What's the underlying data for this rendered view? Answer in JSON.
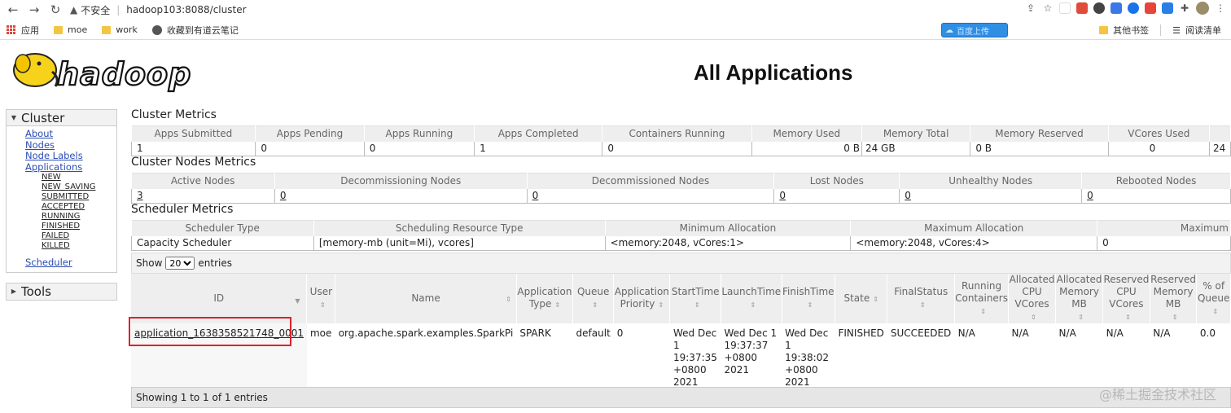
{
  "browser": {
    "security_label": "不安全",
    "url": "hadoop103:8088/cluster",
    "bookmarks": [
      {
        "label": "应用"
      },
      {
        "label": "moe"
      },
      {
        "label": "work"
      },
      {
        "label": "收藏到有道云笔记"
      }
    ],
    "cloud_button_label": "百度上传",
    "other_bookmarks": "其他书签",
    "reading_list": "阅读清单",
    "icons": [
      "back-arrow-icon",
      "forward-arrow-icon",
      "reload-icon",
      "warning-icon",
      "share-icon",
      "star-icon",
      "extensions-icon",
      "profile-avatar-icon"
    ]
  },
  "page": {
    "logo_text": "hadoop",
    "title": "All Applications"
  },
  "sidebar": {
    "cluster_label": "Cluster",
    "links": [
      "About",
      "Nodes",
      "Node Labels",
      "Applications"
    ],
    "app_states": [
      "NEW",
      "NEW_SAVING",
      "SUBMITTED",
      "ACCEPTED",
      "RUNNING",
      "FINISHED",
      "FAILED",
      "KILLED"
    ],
    "scheduler_label": "Scheduler",
    "tools_label": "Tools"
  },
  "cluster_metrics": {
    "title": "Cluster Metrics",
    "headers": [
      "Apps Submitted",
      "Apps Pending",
      "Apps Running",
      "Apps Completed",
      "Containers Running",
      "Memory Used",
      "Memory Total",
      "Memory Reserved",
      "VCores Used",
      ""
    ],
    "values": [
      "1",
      "0",
      "0",
      "1",
      "0",
      "0 B",
      "24 GB",
      "0 B",
      "0",
      "24"
    ]
  },
  "nodes_metrics": {
    "title": "Cluster Nodes Metrics",
    "headers": [
      "Active Nodes",
      "Decommissioning Nodes",
      "Decommissioned Nodes",
      "Lost Nodes",
      "Unhealthy Nodes",
      "Rebooted Nodes"
    ],
    "values": [
      "3",
      "0",
      "0",
      "0",
      "0",
      "0"
    ]
  },
  "scheduler_metrics": {
    "title": "Scheduler Metrics",
    "headers": [
      "Scheduler Type",
      "Scheduling Resource Type",
      "Minimum Allocation",
      "Maximum Allocation",
      "Maximum"
    ],
    "values": [
      "Capacity Scheduler",
      "[memory-mb (unit=Mi), vcores]",
      "<memory:2048, vCores:1>",
      "<memory:2048, vCores:4>",
      "0"
    ]
  },
  "apps_table": {
    "show_label": "Show",
    "page_size": "20",
    "entries_label": "entries",
    "headers": [
      "ID",
      "User",
      "Name",
      "Application Type",
      "Queue",
      "Application Priority",
      "StartTime",
      "LaunchTime",
      "FinishTime",
      "State",
      "FinalStatus",
      "Running Containers",
      "Allocated CPU VCores",
      "Allocated Memory MB",
      "Reserved CPU VCores",
      "Reserved Memory MB",
      "% of Queue"
    ],
    "rows": [
      [
        "application_1638358521748_0001",
        "moe",
        "org.apache.spark.examples.SparkPi",
        "SPARK",
        "default",
        "0",
        "Wed Dec 1 19:37:35 +0800 2021",
        "Wed Dec 1 19:37:37 +0800 2021",
        "Wed Dec 1 19:38:02 +0800 2021",
        "FINISHED",
        "SUCCEEDED",
        "N/A",
        "N/A",
        "N/A",
        "N/A",
        "N/A",
        "0.0"
      ]
    ],
    "footer": "Showing 1 to 1 of 1 entries"
  },
  "watermark": "@稀土掘金技术社区"
}
